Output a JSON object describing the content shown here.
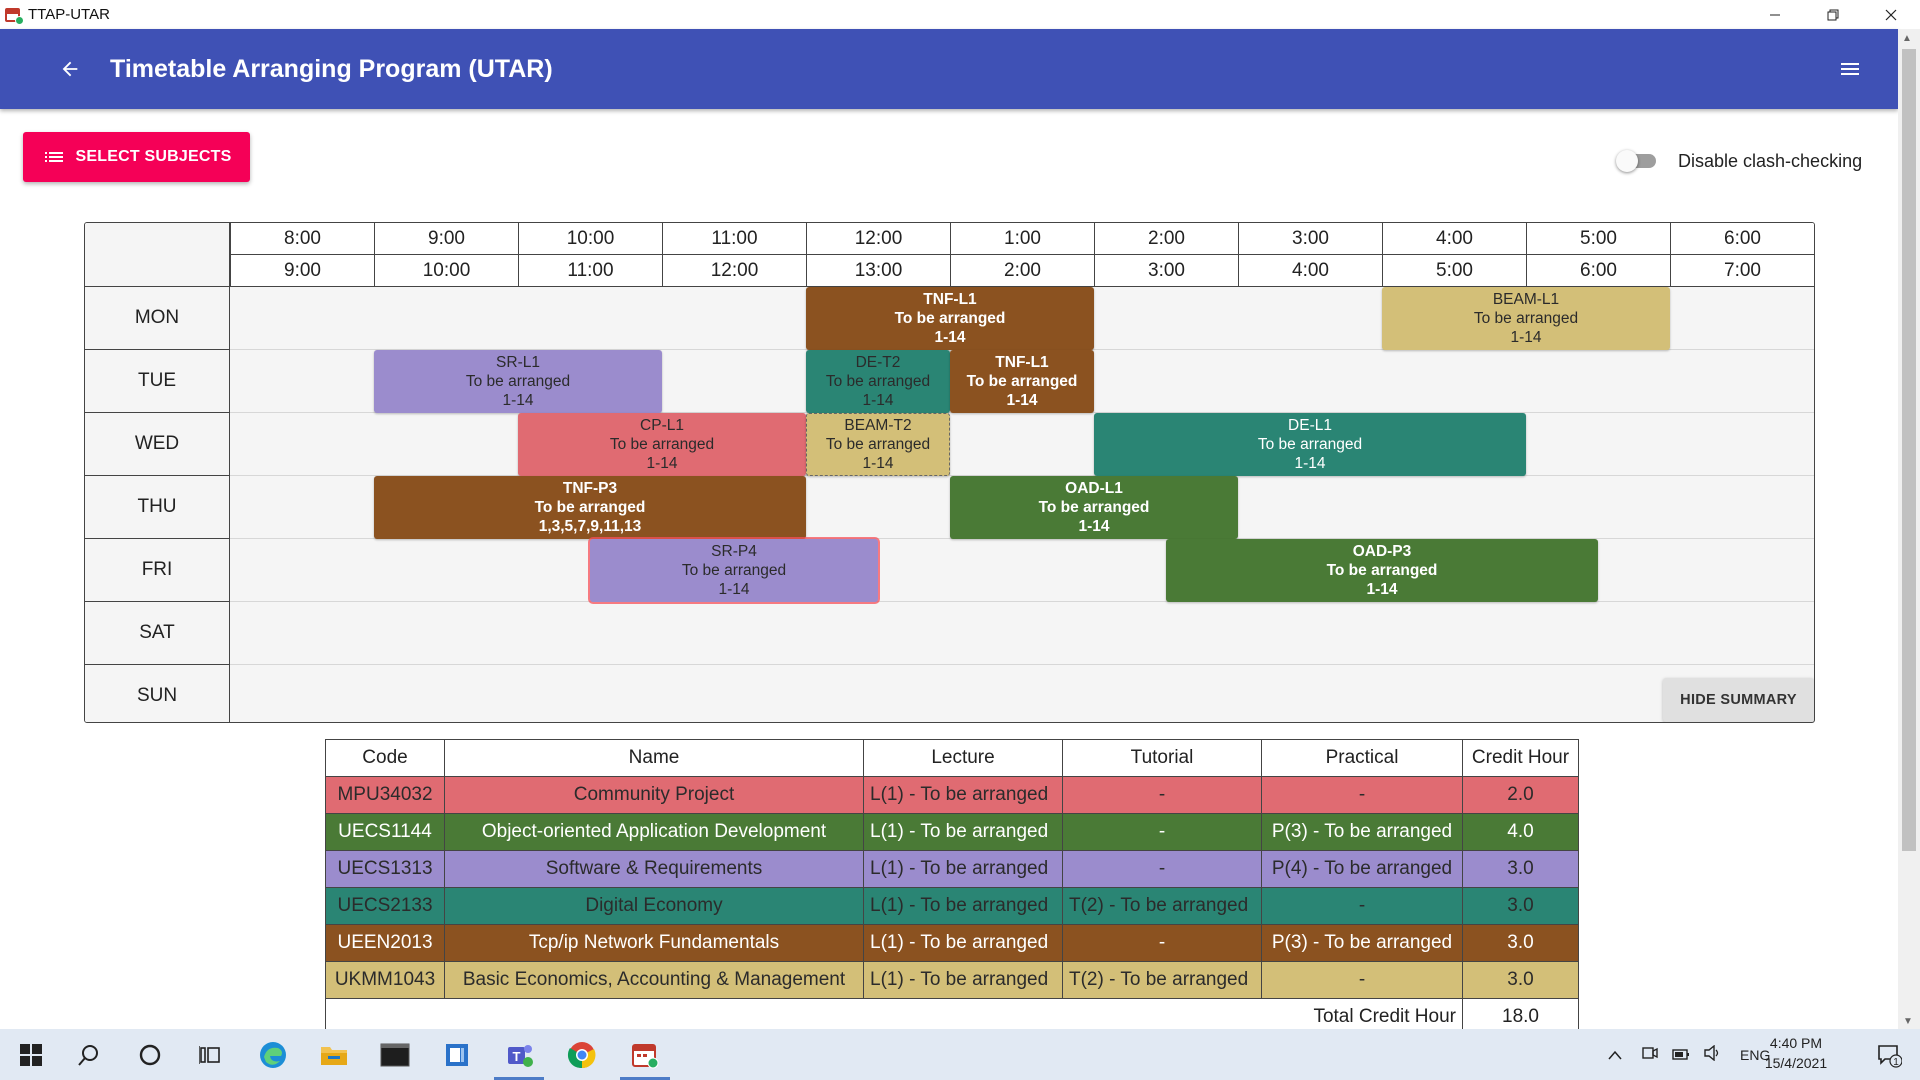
{
  "window": {
    "title": "TTAP-UTAR"
  },
  "appbar": {
    "title": "Timetable Arranging Program (UTAR)"
  },
  "toolbar": {
    "select_subjects_label": "SELECT SUBJECTS",
    "clash_label": "Disable clash-checking",
    "clash_disabled": false
  },
  "timetable": {
    "time_start": [
      "8:00",
      "9:00",
      "10:00",
      "11:00",
      "12:00",
      "1:00",
      "2:00",
      "3:00",
      "4:00",
      "5:00",
      "6:00"
    ],
    "time_end": [
      "9:00",
      "10:00",
      "11:00",
      "12:00",
      "13:00",
      "2:00",
      "3:00",
      "4:00",
      "5:00",
      "6:00",
      "7:00"
    ],
    "days": [
      "MON",
      "TUE",
      "WED",
      "THU",
      "FRI",
      "SAT",
      "SUN"
    ],
    "slots": [
      {
        "day": 0,
        "start": 4,
        "span": 2,
        "code": "TNF-L1",
        "venue": "To be arranged",
        "weeks": "1-14",
        "color": "#8b5220",
        "text": "dark",
        "bold": true
      },
      {
        "day": 0,
        "start": 8,
        "span": 2,
        "code": "BEAM-L1",
        "venue": "To be arranged",
        "weeks": "1-14",
        "color": "#d3bf78",
        "text": "light",
        "bold": false
      },
      {
        "day": 1,
        "start": 1,
        "span": 2,
        "code": "SR-L1",
        "venue": "To be arranged",
        "weeks": "1-14",
        "color": "#9b8ccd",
        "text": "light",
        "bold": false
      },
      {
        "day": 1,
        "start": 4,
        "span": 1,
        "code": "DE-T2",
        "venue": "To be arranged",
        "weeks": "1-14",
        "color": "#2a8574",
        "text": "light",
        "bold": false
      },
      {
        "day": 1,
        "start": 5,
        "span": 1,
        "code": "TNF-L1",
        "venue": "To be arranged",
        "weeks": "1-14",
        "color": "#8b5220",
        "text": "dark",
        "bold": true
      },
      {
        "day": 2,
        "start": 2,
        "span": 2,
        "code": "CP-L1",
        "venue": "To be arranged",
        "weeks": "1-14",
        "color": "#e06b72",
        "text": "light",
        "bold": false
      },
      {
        "day": 2,
        "start": 4,
        "span": 1,
        "code": "BEAM-T2",
        "venue": "To be arranged",
        "weeks": "1-14",
        "color": "#d3bf78",
        "text": "light",
        "bold": false,
        "dashed": true
      },
      {
        "day": 2,
        "start": 6,
        "span": 3,
        "code": "DE-L1",
        "venue": "To be arranged",
        "weeks": "1-14",
        "color": "#2a8574",
        "text": "dark",
        "bold": false
      },
      {
        "day": 3,
        "start": 1,
        "span": 3,
        "code": "TNF-P3",
        "venue": "To be arranged",
        "weeks": "1,3,5,7,9,11,13",
        "color": "#8b5220",
        "text": "dark",
        "bold": true
      },
      {
        "day": 3,
        "start": 5,
        "span": 2,
        "code": "OAD-L1",
        "venue": "To be arranged",
        "weeks": "1-14",
        "color": "#4a7a36",
        "text": "dark",
        "bold": true
      },
      {
        "day": 4,
        "start": 2.5,
        "span": 2,
        "code": "SR-P4",
        "venue": "To be arranged",
        "weeks": "1-14",
        "color": "#9b8ccd",
        "text": "light",
        "bold": false,
        "glow": true
      },
      {
        "day": 4,
        "start": 6.5,
        "span": 3,
        "code": "OAD-P3",
        "venue": "To be arranged",
        "weeks": "1-14",
        "color": "#4a7a36",
        "text": "dark",
        "bold": true
      }
    ],
    "hide_summary_label": "HIDE SUMMARY"
  },
  "summary": {
    "headers": [
      "Code",
      "Name",
      "Lecture",
      "Tutorial",
      "Practical",
      "Credit Hour"
    ],
    "rows": [
      {
        "code": "MPU34032",
        "name": "Community Project",
        "lecture": "L(1) - To be arranged",
        "tutorial": "-",
        "practical": "-",
        "credit": "2.0",
        "color": "#e06b72",
        "text": "light"
      },
      {
        "code": "UECS1144",
        "name": "Object-oriented Application Development",
        "lecture": "L(1) - To be arranged",
        "tutorial": "-",
        "practical": "P(3) - To be arranged",
        "credit": "4.0",
        "color": "#4a7a36",
        "text": "dark"
      },
      {
        "code": "UECS1313",
        "name": "Software & Requirements",
        "lecture": "L(1) - To be arranged",
        "tutorial": "-",
        "practical": "P(4) - To be arranged",
        "credit": "3.0",
        "color": "#9b8ccd",
        "text": "light"
      },
      {
        "code": "UECS2133",
        "name": "Digital Economy",
        "lecture": "L(1) - To be arranged",
        "tutorial": "T(2) - To be arranged",
        "practical": "-",
        "credit": "3.0",
        "color": "#2a8574",
        "text": "light"
      },
      {
        "code": "UEEN2013",
        "name": "Tcp/ip Network Fundamentals",
        "lecture": "L(1) - To be arranged",
        "tutorial": "-",
        "practical": "P(3) - To be arranged",
        "credit": "3.0",
        "color": "#8b5220",
        "text": "dark"
      },
      {
        "code": "UKMM1043",
        "name": "Basic Economics, Accounting & Management",
        "lecture": "L(1) - To be arranged",
        "tutorial": "T(2) - To be arranged",
        "practical": "-",
        "credit": "3.0",
        "color": "#d3bf78",
        "text": "light"
      }
    ],
    "total_label": "Total Credit Hour",
    "total_value": "18.0"
  },
  "taskbar": {
    "apps": [
      "windows-start-icon",
      "search-icon",
      "cortana-icon",
      "task-view-icon",
      "edge-icon",
      "file-explorer-icon",
      "terminal-icon",
      "notepad-app-icon",
      "teams-icon",
      "chrome-icon",
      "ttap-app-icon"
    ],
    "lang": "ENG",
    "time": "4:40 PM",
    "date": "15/4/2021",
    "notification_count": "1"
  }
}
